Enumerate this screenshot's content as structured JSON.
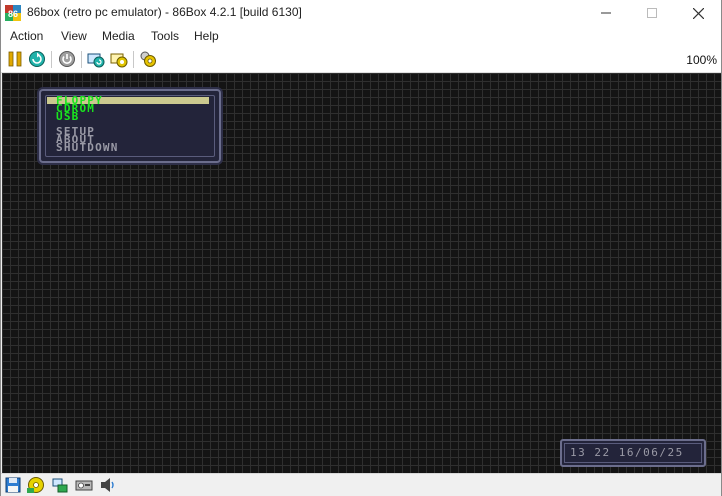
{
  "window": {
    "title": "86box (retro pc emulator) - 86Box 4.2.1 [build 6130]",
    "app_icon": "86box-icon",
    "controls": {
      "minimize_icon": "minimize-icon",
      "maximize_icon": "maximize-icon",
      "close_icon": "close-icon"
    }
  },
  "menubar": {
    "items": [
      "Action",
      "View",
      "Media",
      "Tools",
      "Help"
    ]
  },
  "toolbar": {
    "buttons": [
      "pause-icon",
      "reset-icon",
      "power-icon",
      "ctrl-alt-del-icon",
      "ctrl-alt-esc-icon",
      "settings-icon"
    ],
    "zoom": "100%"
  },
  "screen": {
    "menu_options": [
      {
        "label": "FLOPPY",
        "color": "#19e61e",
        "selected": true
      },
      {
        "label": "CDROM",
        "color": "#19e61e"
      },
      {
        "label": "USB",
        "color": "#19e61e"
      },
      {
        "label": "SETUP",
        "color": "#9a9aa6"
      },
      {
        "label": "ABOUT",
        "color": "#9a9aa6"
      },
      {
        "label": "SHUTDOWN",
        "color": "#9a9aa6"
      }
    ],
    "clock": "13 22 16/06/25"
  },
  "statusbar": {
    "icons": [
      "floppy-disk-icon",
      "cdrom-icon",
      "network-icon",
      "hard-disk-icon",
      "sound-icon"
    ]
  }
}
